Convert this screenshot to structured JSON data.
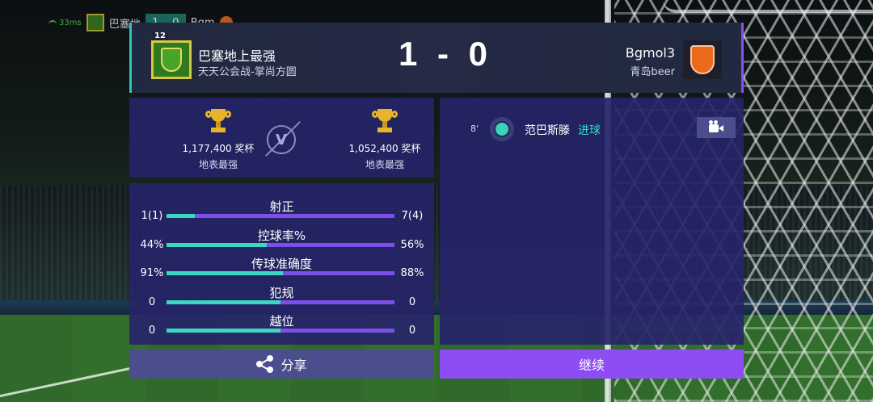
{
  "hud": {
    "ping": "33ms",
    "home_short": "巴塞地",
    "score_home": "1",
    "score_away": "0",
    "away_short": "Bgm"
  },
  "header": {
    "home": {
      "level": "12",
      "name": "巴塞地上最强",
      "guild": "天天公会战-掌尚方圆"
    },
    "score": {
      "home": "1",
      "sep": "-",
      "away": "0"
    },
    "away": {
      "name": "Bgmol3",
      "guild": "青岛beer"
    }
  },
  "trophies": {
    "home": {
      "count": "1,177,400 奖杯",
      "rank": "地表最强"
    },
    "vs": "V",
    "away": {
      "count": "1,052,400 奖杯",
      "rank": "地表最强"
    }
  },
  "stats": [
    {
      "label": "射正",
      "home": "1(1)",
      "away": "7(4)",
      "home_share": 0.125
    },
    {
      "label": "控球率%",
      "home": "44%",
      "away": "56%",
      "home_share": 0.44
    },
    {
      "label": "传球准确度",
      "home": "91%",
      "away": "88%",
      "home_share": 0.51
    },
    {
      "label": "犯规",
      "home": "0",
      "away": "0",
      "home_share": 0.5
    },
    {
      "label": "越位",
      "home": "0",
      "away": "0",
      "home_share": 0.5
    }
  ],
  "events": [
    {
      "minute": "8'",
      "player": "范巴斯滕",
      "type": "进球"
    }
  ],
  "buttons": {
    "share": "分享",
    "continue": "继续"
  },
  "colors": {
    "home_accent": "#3ad8c3",
    "away_accent": "#7c4fe7",
    "continue_bg": "#8e4df2",
    "panel_bg": "#262468"
  },
  "icons": {
    "replay": "video-camera-icon",
    "share": "share-icon",
    "event": "football-icon",
    "trophy": "trophy-icon"
  }
}
